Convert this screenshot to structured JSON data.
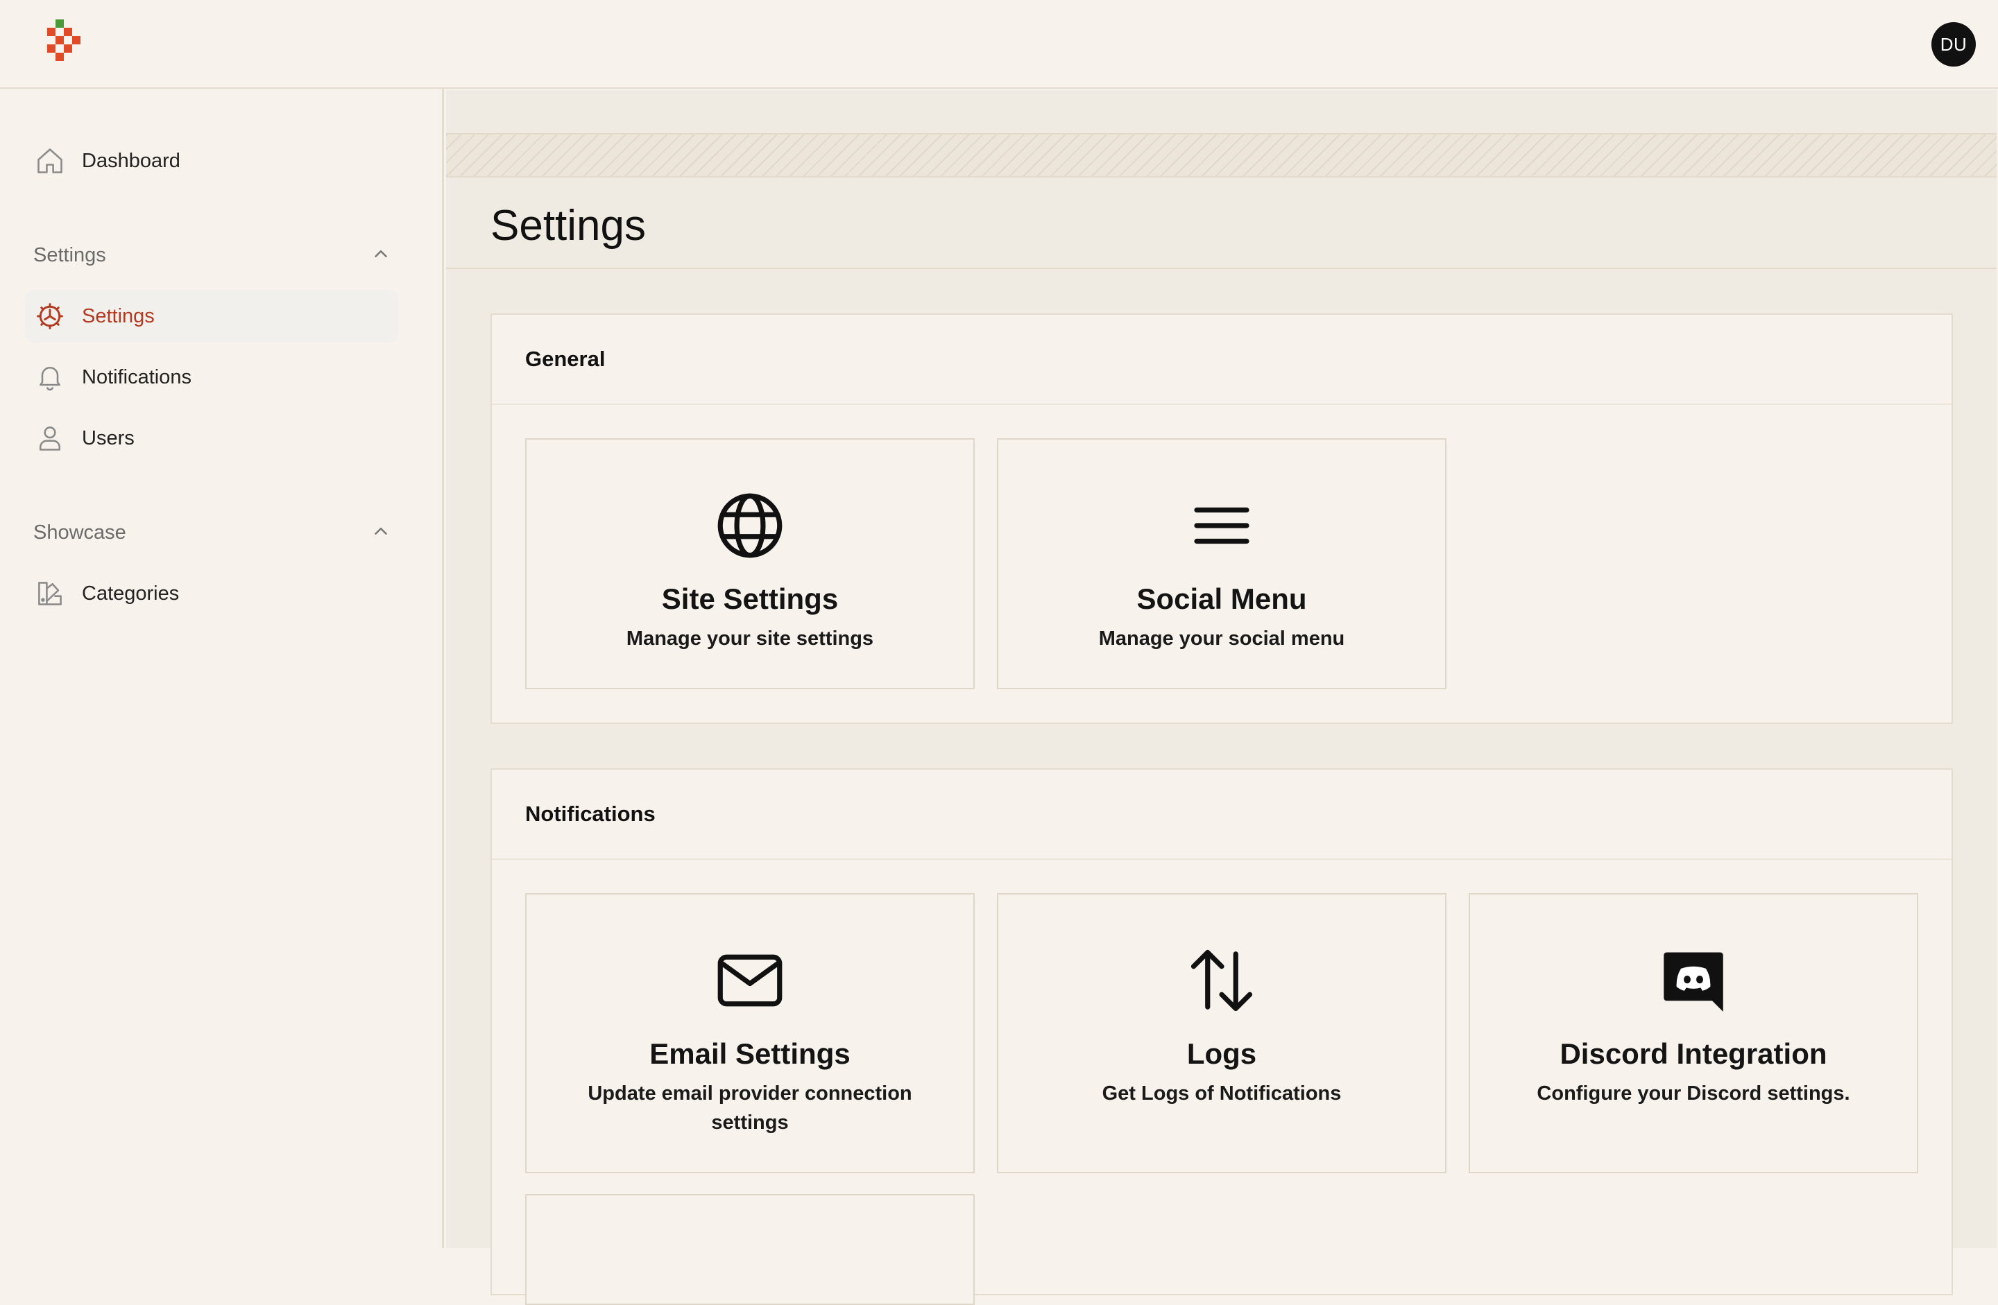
{
  "header": {
    "logo_icon": "pixel-logo",
    "avatar_initials": "DU"
  },
  "sidebar": {
    "dashboard": {
      "label": "Dashboard",
      "icon": "home-icon"
    },
    "groups": [
      {
        "label": "Settings",
        "icon": "chevron-up-icon",
        "items": [
          {
            "label": "Settings",
            "icon": "gear-icon",
            "active": true
          },
          {
            "label": "Notifications",
            "icon": "bell-icon",
            "active": false
          },
          {
            "label": "Users",
            "icon": "user-icon",
            "active": false
          }
        ]
      },
      {
        "label": "Showcase",
        "icon": "chevron-up-icon",
        "items": [
          {
            "label": "Categories",
            "icon": "swatch-icon",
            "active": false
          }
        ]
      }
    ]
  },
  "main": {
    "title": "Settings",
    "sections": [
      {
        "title": "General",
        "cards": [
          {
            "icon": "globe-icon",
            "title": "Site Settings",
            "description": "Manage your site settings"
          },
          {
            "icon": "menu-icon",
            "title": "Social Menu",
            "description": "Manage your social menu"
          }
        ]
      },
      {
        "title": "Notifications",
        "cards": [
          {
            "icon": "envelope-icon",
            "title": "Email Settings",
            "description": "Update email provider connection settings"
          },
          {
            "icon": "arrows-up-down-icon",
            "title": "Logs",
            "description": "Get Logs of Notifications"
          },
          {
            "icon": "discord-icon",
            "title": "Discord Integration",
            "description": "Configure your Discord settings."
          }
        ]
      }
    ]
  },
  "colors": {
    "background": "#f7f3ec",
    "main_background": "#efebe2",
    "accent": "#b33a21",
    "border": "#e4ddcf",
    "logo_green": "#4a9a3a",
    "logo_red": "#e04a26"
  }
}
